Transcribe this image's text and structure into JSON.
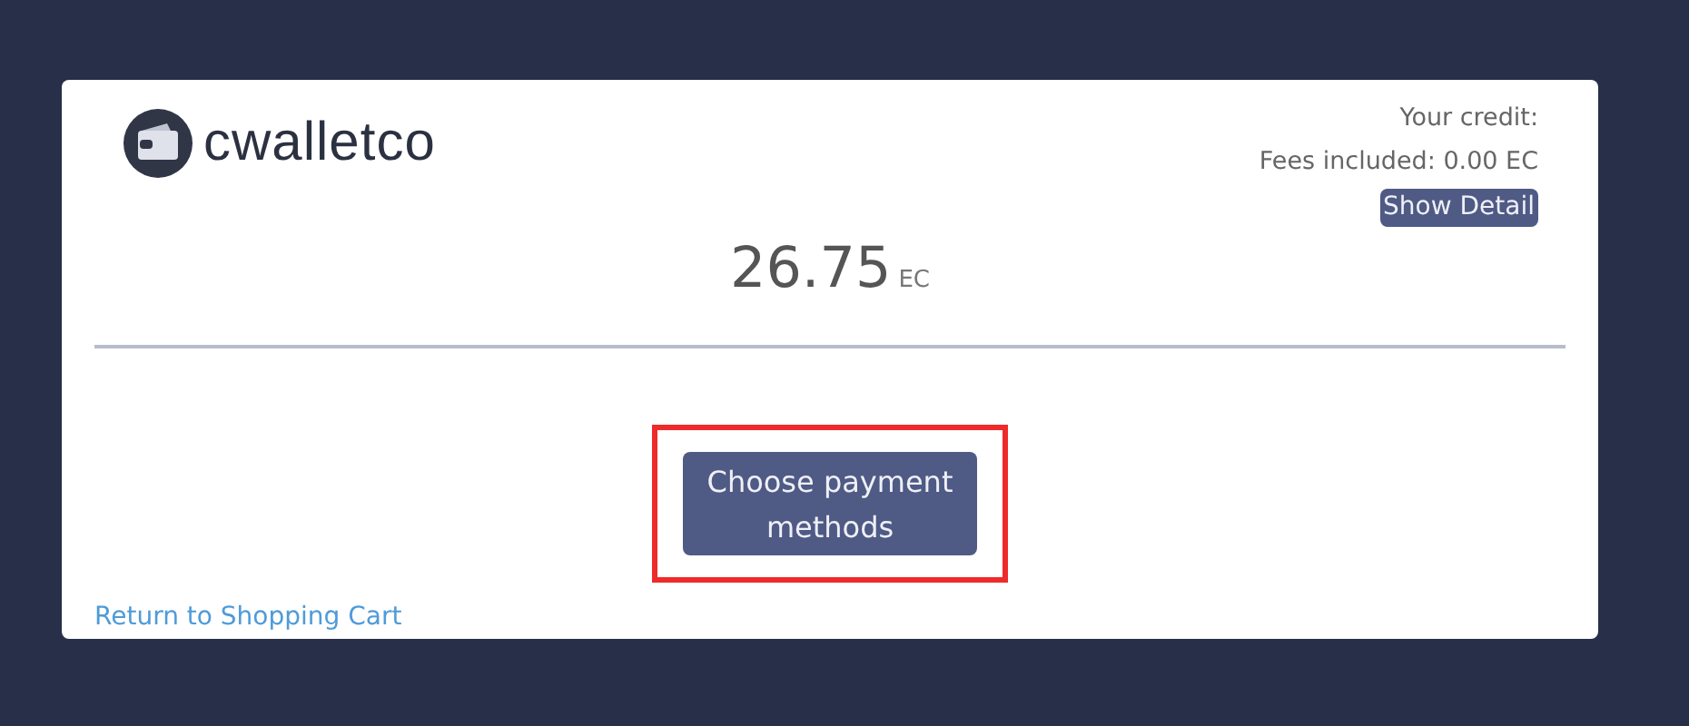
{
  "brand": {
    "name": "cwalletco"
  },
  "credit": {
    "label": "Your credit:",
    "fees": "Fees included: 0.00 EC",
    "detail_button": "Show Detail"
  },
  "amount": {
    "value": "26.75",
    "unit": "EC"
  },
  "payment_button": {
    "label": "Choose payment methods",
    "highlighted": true
  },
  "return_link": "Return to Shopping Cart"
}
